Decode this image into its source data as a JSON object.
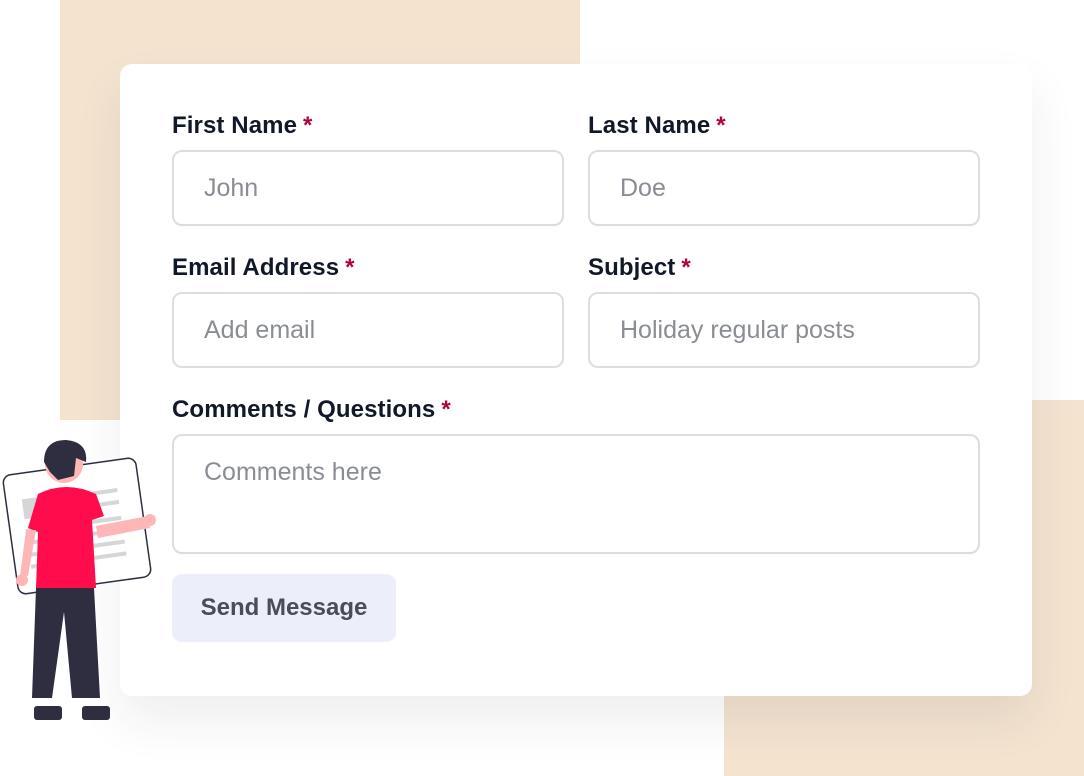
{
  "form": {
    "first_name": {
      "label": "First Name",
      "required_mark": "*",
      "placeholder": "John"
    },
    "last_name": {
      "label": "Last Name",
      "required_mark": "*",
      "placeholder": "Doe"
    },
    "email": {
      "label": "Email Address",
      "required_mark": "*",
      "placeholder": "Add email"
    },
    "subject": {
      "label": "Subject",
      "required_mark": "*",
      "placeholder": "Holiday regular posts"
    },
    "comments": {
      "label": "Comments / Questions",
      "required_mark": "*",
      "placeholder": "Comments here"
    },
    "submit_label": "Send Message"
  },
  "colors": {
    "background_blob": "#f3e3cf",
    "required_mark": "#b0043a",
    "button_background": "#eceef9",
    "figure_shirt": "#ff0c4d",
    "figure_pants": "#2f2e41"
  },
  "illustration": {
    "name": "person-holding-document-illustration"
  }
}
